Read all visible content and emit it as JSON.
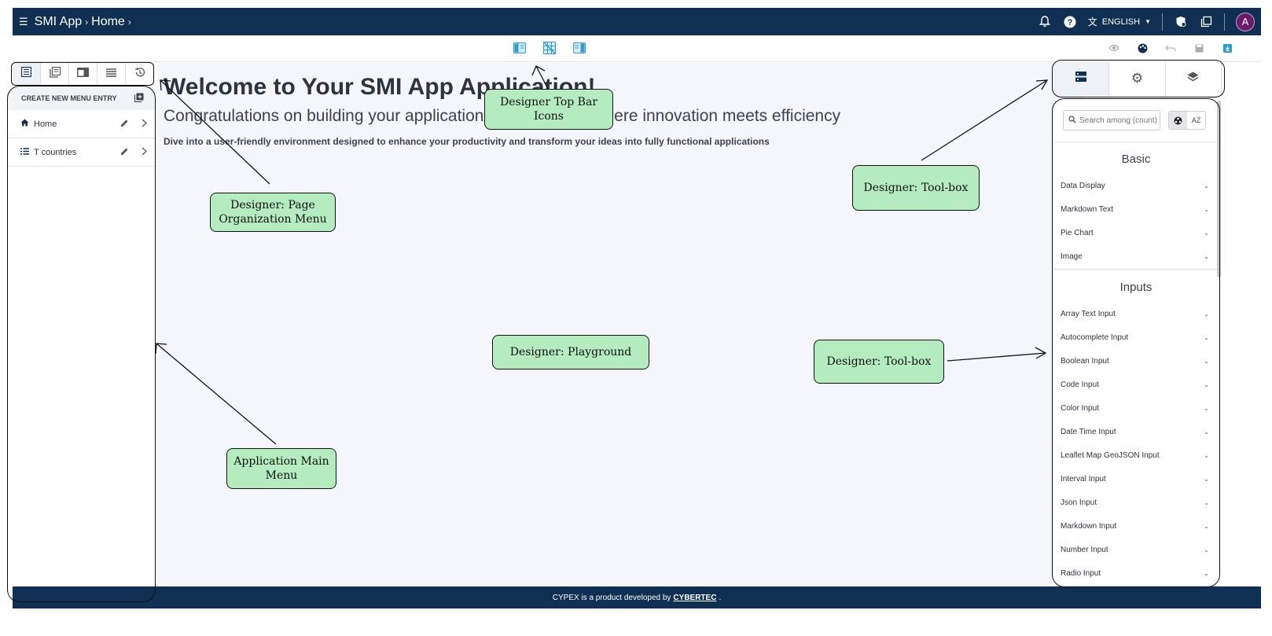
{
  "appbar": {
    "breadcrumb": [
      "SMI App",
      "Home"
    ],
    "language": "ENGLISH",
    "avatar_initial": "A"
  },
  "left_panel": {
    "create_label": "CREATE NEW MENU ENTRY",
    "items": [
      {
        "label": "Home",
        "icon": "home-icon"
      },
      {
        "label": "T countries",
        "icon": "list-icon"
      }
    ]
  },
  "playground": {
    "title": "Welcome to Your SMI App Application!",
    "subtitle": "Congratulations on building your application with CYPEX - where innovation meets efficiency",
    "description": "Dive into a user-friendly environment designed to enhance your productivity and transform your ideas into fully functional applications"
  },
  "toolbox": {
    "search_placeholder": "Search among (count)",
    "sort_label": "AZ",
    "sections": [
      {
        "title": "Basic",
        "items": [
          "Data Display",
          "Markdown Text",
          "Pie Chart",
          "Image"
        ]
      },
      {
        "title": "Inputs",
        "items": [
          "Array Text Input",
          "Autocomplete Input",
          "Boolean Input",
          "Code Input",
          "Color Input",
          "Date Time Input",
          "Leaflet Map GeoJSON Input",
          "Interval Input",
          "Json Input",
          "Markdown Input",
          "Number Input",
          "Radio Input"
        ]
      }
    ]
  },
  "footer": {
    "text": "CYPEX is a product developed by",
    "link": "CYBERTEC",
    "end": "."
  },
  "annotations": {
    "top_bar_icons": "Designer Top Bar Icons",
    "page_org_menu": "Designer: Page Organization Menu",
    "toolbox_top": "Designer: Tool-box",
    "playground": "Designer: Playground",
    "toolbox_mid": "Designer: Tool-box",
    "main_menu": "Application Main Menu"
  },
  "colors": {
    "appbar": "#0f3052",
    "accent": "#2c9bd6",
    "note_bg": "#b4ecc0",
    "playground_bg": "#f5f6fb"
  }
}
